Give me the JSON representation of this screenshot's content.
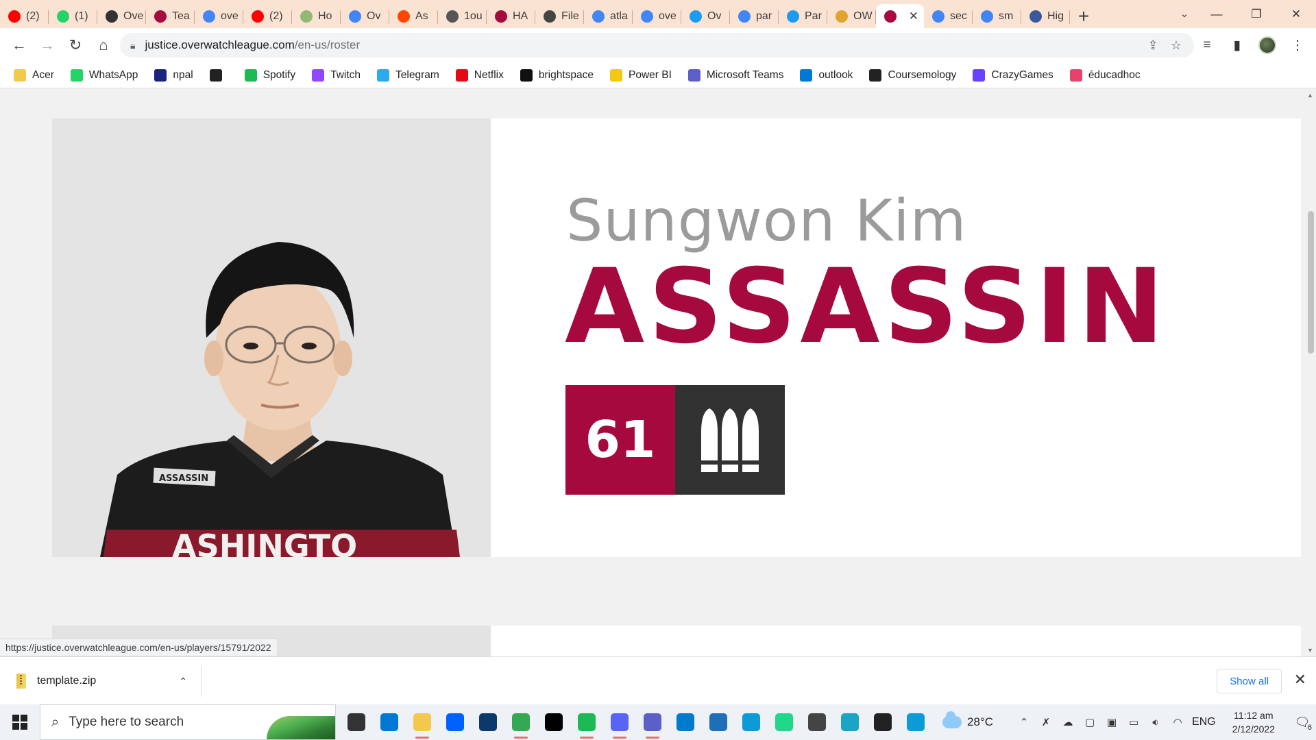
{
  "browser": {
    "tabs": [
      {
        "label": "(2)",
        "icon": "youtube-icon",
        "color": "#ff0000"
      },
      {
        "label": "(1)",
        "icon": "whatsapp-icon",
        "color": "#25d366"
      },
      {
        "label": "Ove",
        "icon": "overwatch-icon",
        "color": "#333333"
      },
      {
        "label": "Tea",
        "icon": "justice-icon",
        "color": "#a6093d"
      },
      {
        "label": "ove",
        "icon": "google-icon",
        "color": "#4285f4"
      },
      {
        "label": "(2)",
        "icon": "youtube-icon",
        "color": "#ff0000"
      },
      {
        "label": "Ho",
        "icon": "wikihow-icon",
        "color": "#93b874"
      },
      {
        "label": "Ov",
        "icon": "google-icon",
        "color": "#4285f4"
      },
      {
        "label": "As",
        "icon": "reddit-icon",
        "color": "#ff4500"
      },
      {
        "label": "1ou",
        "icon": "globe-icon",
        "color": "#555555"
      },
      {
        "label": "HA",
        "icon": "justice-icon",
        "color": "#a6093d"
      },
      {
        "label": "File",
        "icon": "file-icon",
        "color": "#444444"
      },
      {
        "label": "atla",
        "icon": "google-icon",
        "color": "#4285f4"
      },
      {
        "label": "ove",
        "icon": "google-icon",
        "color": "#4285f4"
      },
      {
        "label": "Ov",
        "icon": "twitter-icon",
        "color": "#1d9bf0"
      },
      {
        "label": "par",
        "icon": "google-icon",
        "color": "#4285f4"
      },
      {
        "label": "Par",
        "icon": "twitter-icon",
        "color": "#1d9bf0"
      },
      {
        "label": "OW",
        "icon": "coin-icon",
        "color": "#e0a42c"
      },
      {
        "label": "",
        "icon": "justice-icon",
        "color": "#a6093d",
        "active": true
      },
      {
        "label": "sec",
        "icon": "google-icon",
        "color": "#4285f4"
      },
      {
        "label": "sm",
        "icon": "google-icon",
        "color": "#4285f4"
      },
      {
        "label": "Hig",
        "icon": "globe-icon",
        "color": "#3b5998"
      }
    ],
    "url_host": "justice.overwatchleague.com",
    "url_path": "/en-us/roster",
    "bookmarks": [
      {
        "label": "Acer",
        "icon": "folder-icon",
        "color": "#f2c94c"
      },
      {
        "label": "WhatsApp",
        "icon": "whatsapp-icon",
        "color": "#25d366"
      },
      {
        "label": "npal",
        "icon": "npal-icon",
        "color": "#1a237e"
      },
      {
        "label": "",
        "icon": "globe-icon",
        "color": "#222222"
      },
      {
        "label": "Spotify",
        "icon": "spotify-icon",
        "color": "#1db954"
      },
      {
        "label": "Twitch",
        "icon": "twitch-icon",
        "color": "#9146ff"
      },
      {
        "label": "Telegram",
        "icon": "telegram-icon",
        "color": "#2aabee"
      },
      {
        "label": "Netflix",
        "icon": "netflix-icon",
        "color": "#e50914"
      },
      {
        "label": "brightspace",
        "icon": "np-icon",
        "color": "#111111"
      },
      {
        "label": "Power BI",
        "icon": "powerbi-icon",
        "color": "#f2c811"
      },
      {
        "label": "Microsoft Teams",
        "icon": "teams-icon",
        "color": "#5b5fc7"
      },
      {
        "label": "outlook",
        "icon": "outlook-icon",
        "color": "#0078d4"
      },
      {
        "label": "Coursemology",
        "icon": "coursemology-icon",
        "color": "#222222"
      },
      {
        "label": "CrazyGames",
        "icon": "crazygames-icon",
        "color": "#6842ff"
      },
      {
        "label": "éducadhoc",
        "icon": "educadhoc-icon",
        "color": "#e6436b"
      }
    ]
  },
  "player": {
    "real_name": "Sungwon Kim",
    "handle": "ASSASSIN",
    "number": "61",
    "role_icon": "damage-role-icon",
    "jersey_tag": "ASSASSIN",
    "jersey_text": "ASHINGTO"
  },
  "colors": {
    "team_red": "#a6093d",
    "dark_badge": "#323232",
    "name_gray": "#9b9b9b"
  },
  "status_url": "https://justice.overwatchleague.com/en-us/players/15791/2022",
  "download": {
    "filename": "template.zip",
    "show_all": "Show all"
  },
  "taskbar": {
    "search_placeholder": "Type here to search",
    "apps": [
      {
        "icon": "task-view-icon",
        "color": "#333333"
      },
      {
        "icon": "mail-icon",
        "color": "#0078d4"
      },
      {
        "icon": "file-explorer-icon",
        "color": "#f2c94c",
        "open": true
      },
      {
        "icon": "dropbox-icon",
        "color": "#0061ff"
      },
      {
        "icon": "store-icon",
        "color": "#0a3a6b"
      },
      {
        "icon": "chrome-icon",
        "color": "#34a853",
        "open": true
      },
      {
        "icon": "netflix-icon",
        "color": "#000000"
      },
      {
        "icon": "spotify-icon",
        "color": "#1db954",
        "open": true
      },
      {
        "icon": "discord-icon",
        "color": "#5865f2",
        "open": true
      },
      {
        "icon": "teams-icon",
        "color": "#5b5fc7",
        "open": true
      },
      {
        "icon": "vscode-icon",
        "color": "#007acc"
      },
      {
        "icon": "photos-icon",
        "color": "#1e6fb8"
      },
      {
        "icon": "edge-icon",
        "color": "#0c9bd7"
      },
      {
        "icon": "pycharm-icon",
        "color": "#21d789"
      },
      {
        "icon": "unity-icon",
        "color": "#444444"
      },
      {
        "icon": "maya-icon",
        "color": "#1ba5c4"
      },
      {
        "icon": "unity-hub-icon",
        "color": "#222222"
      },
      {
        "icon": "edge-icon",
        "color": "#0c9bd7"
      }
    ],
    "weather": "28°C",
    "language": "ENG",
    "time": "11:12 am",
    "date": "2/12/2022",
    "notification_count": "6"
  }
}
